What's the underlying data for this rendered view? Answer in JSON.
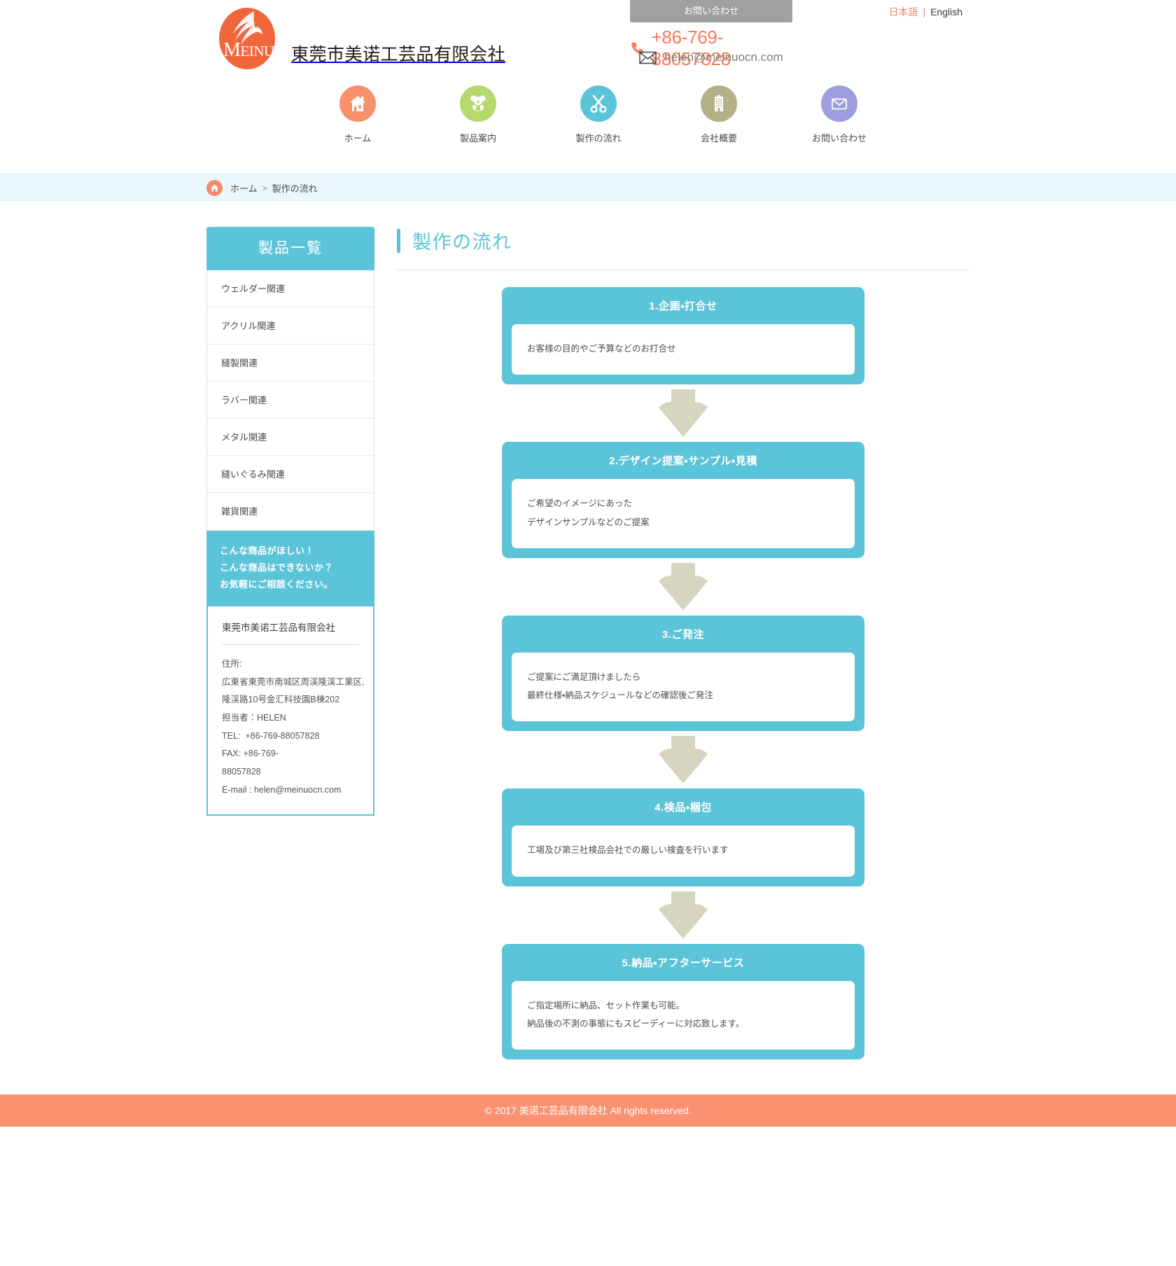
{
  "header": {
    "logo_text_main": "M",
    "logo_text_rest": "EINUO",
    "brand_name": "東莞市美诺工芸品有限会社",
    "contact_button": "お問い合わせ",
    "phone": "+86-769-88057828",
    "email": "helen@meinuocn.com",
    "lang_ja": "日本語",
    "lang_sep": "|",
    "lang_en": "English",
    "phone_icon": "phone-icon",
    "mail_icon": "mail-icon",
    "accent_orange": "#fa7a55",
    "accent_cyan": "#5cc4d8"
  },
  "nav": {
    "items": [
      {
        "label": "ホーム",
        "icon": "home-icon",
        "color": "#f9906c"
      },
      {
        "label": "製品案内",
        "icon": "bear-icon",
        "color": "#b5d96e"
      },
      {
        "label": "製作の流れ",
        "icon": "scissors-icon",
        "color": "#5cc4d8"
      },
      {
        "label": "会社概要",
        "icon": "building-icon",
        "color": "#b4b088"
      },
      {
        "label": "お問い合わせ",
        "icon": "envelope-icon",
        "color": "#9d9ee0"
      }
    ]
  },
  "breadcrumb": {
    "home_icon": "home-icon",
    "home": "ホーム",
    "separator": ">",
    "current": "製作の流れ"
  },
  "sidebar": {
    "heading": "製品一覧",
    "items": [
      {
        "label": "ウェルダー関連"
      },
      {
        "label": "アクリル関連"
      },
      {
        "label": "縫製関連"
      },
      {
        "label": "ラバー関連"
      },
      {
        "label": "メタル関連"
      },
      {
        "label": "縫いぐるみ関連"
      },
      {
        "label": "雑貨関連"
      }
    ],
    "cta": "こんな商品がほしい！\nこんな商品はできないか？\nお気軽にご相談ください。",
    "card_title": "東莞市美诺工芸品有限会社",
    "card_lines": [
      "住所:",
      "広東省東莞市南城区周渓隆渓工業区,",
      "隆渓路10号金汇科技園B棟202",
      "担当者：HELEN",
      "TEL:  +86-769-88057828",
      "FAX: +86-769-",
      "88057828",
      "E-mail : helen@meinuocn.com"
    ]
  },
  "main": {
    "page_title": "製作の流れ",
    "steps": [
      {
        "title": "1.企画・打合せ",
        "body": "お客様の目的やご予算などのお打合せ"
      },
      {
        "title": "2.デザイン提案・サンプル・見積",
        "body": "ご希望のイメージにあった\nデザインサンプルなどのご提案"
      },
      {
        "title": "3.ご発注",
        "body": "ご提案にご満足頂けましたら\n最終仕様・納品スケジュールなどの確認後ご発注"
      },
      {
        "title": "4.検品・梱包",
        "body": "工場及び第三社検品会社での厳しい検査を行います"
      },
      {
        "title": "5.納品・アフターサービス",
        "body": "ご指定場所に納品、セット作業も可能。\n納品後の不測の事態にもスピーディーに対応致します。"
      }
    ],
    "arrow_icon": "down-arrow-icon",
    "arrow_color": "#d6d6c0"
  },
  "footer": {
    "copyright": "© 2017 美诺工芸品有限会社 All rights reserved.",
    "background": "#fa9272"
  }
}
